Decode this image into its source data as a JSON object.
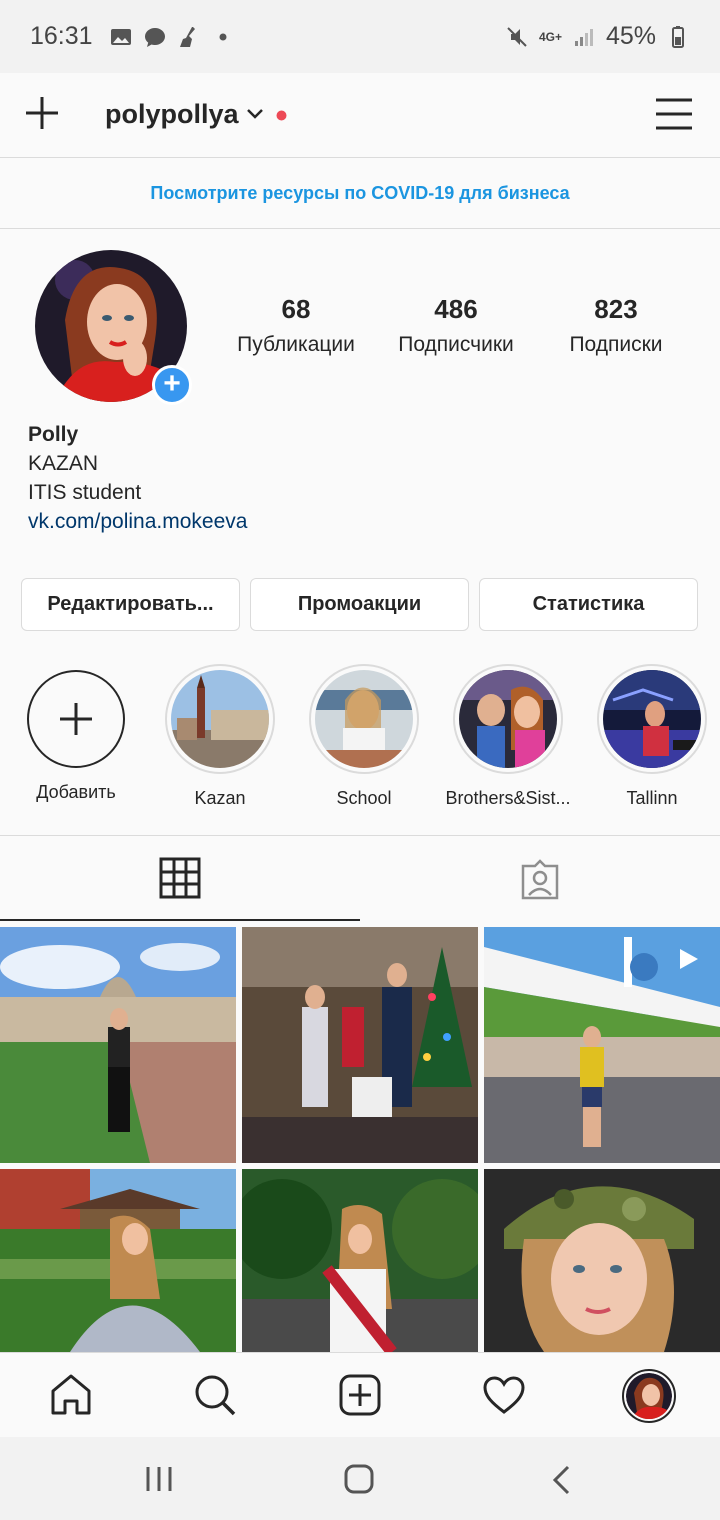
{
  "status_bar": {
    "time": "16:31",
    "network": "4G+",
    "battery": "45%"
  },
  "header": {
    "username": "polypollya"
  },
  "covid_banner": "Посмотрите ресурсы по COVID-19 для бизнеса",
  "stats": [
    {
      "value": "68",
      "label": "Публикации"
    },
    {
      "value": "486",
      "label": "Подписчики"
    },
    {
      "value": "823",
      "label": "Подписки"
    }
  ],
  "bio": {
    "name": "Polly",
    "line1": "KAZAN",
    "line2": "ITIS student",
    "link": "vk.com/polina.mokeeva"
  },
  "buttons": {
    "edit": "Редактировать...",
    "promo": "Промоакции",
    "stats": "Статистика"
  },
  "highlights": [
    {
      "label": "Добавить"
    },
    {
      "label": "Kazan"
    },
    {
      "label": "School"
    },
    {
      "label": "Brothers&Sist..."
    },
    {
      "label": "Tallinn"
    }
  ],
  "colors": {
    "accent": "#3897f0",
    "link": "#1b95e0",
    "notification": "#ed4956"
  }
}
